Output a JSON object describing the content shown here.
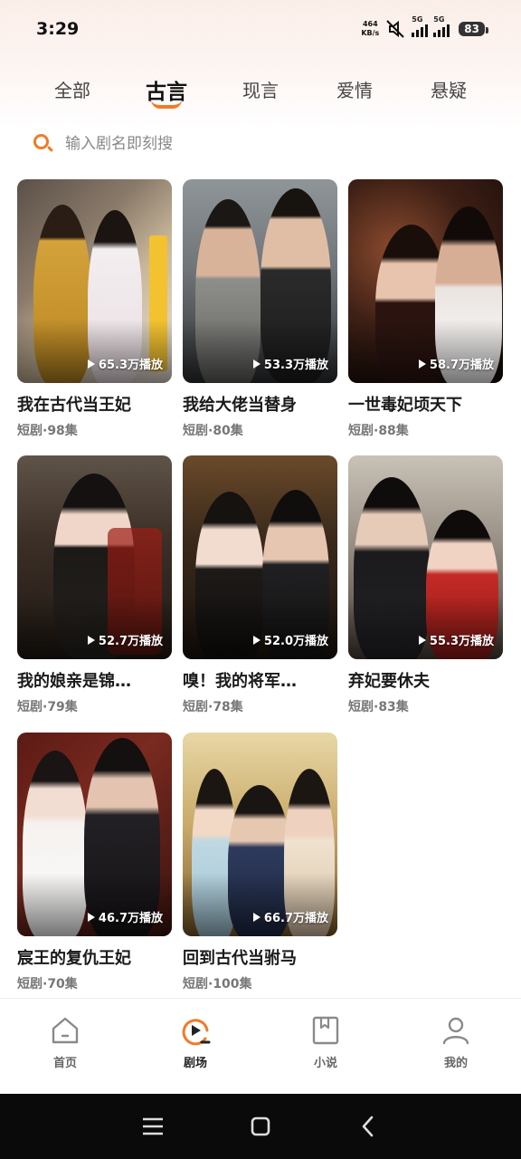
{
  "status_bar": {
    "time": "3:29",
    "net_speed_value": "464",
    "net_speed_unit": "KB/s",
    "sim1": "5G",
    "sim2": "5G",
    "battery": "83"
  },
  "tabs": [
    {
      "label": "全部",
      "active": false
    },
    {
      "label": "古言",
      "active": true
    },
    {
      "label": "现言",
      "active": false
    },
    {
      "label": "爱情",
      "active": false
    },
    {
      "label": "悬疑",
      "active": false
    }
  ],
  "search": {
    "placeholder": "输入剧名即刻搜"
  },
  "dramas": [
    {
      "title": "我在古代当王妃",
      "episodes": "短剧·98集",
      "plays": "65.3万播放"
    },
    {
      "title": "我给大佬当替身",
      "episodes": "短剧·80集",
      "plays": "53.3万播放"
    },
    {
      "title": "一世毒妃顷天下",
      "episodes": "短剧·88集",
      "plays": "58.7万播放"
    },
    {
      "title": "我的娘亲是锦…",
      "episodes": "短剧·79集",
      "plays": "52.7万播放"
    },
    {
      "title": "嗅！我的将军…",
      "episodes": "短剧·78集",
      "plays": "52.0万播放"
    },
    {
      "title": "弃妃要休夫",
      "episodes": "短剧·83集",
      "plays": "55.3万播放"
    },
    {
      "title": "宸王的复仇王妃",
      "episodes": "短剧·70集",
      "plays": "46.7万播放"
    },
    {
      "title": "回到古代当驸马",
      "episodes": "短剧·100集",
      "plays": "66.7万播放"
    }
  ],
  "bottom_nav": [
    {
      "label": "首页",
      "icon": "home-icon",
      "active": false
    },
    {
      "label": "剧场",
      "icon": "play-circle-icon",
      "active": true
    },
    {
      "label": "小说",
      "icon": "book-icon",
      "active": false
    },
    {
      "label": "我的",
      "icon": "user-icon",
      "active": false
    }
  ],
  "colors": {
    "accent": "#f27a26"
  }
}
